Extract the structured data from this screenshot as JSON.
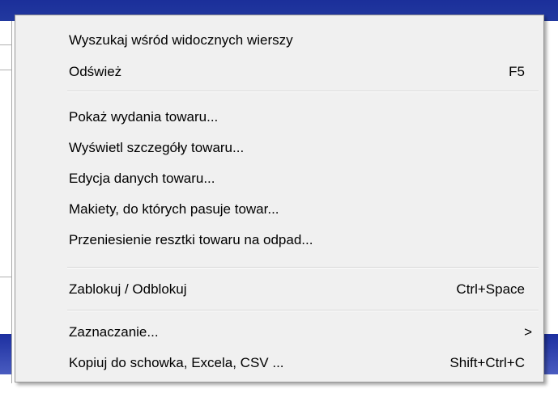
{
  "context_menu": {
    "items": [
      {
        "label": "Wyszukaj wśród widocznych wierszy",
        "shortcut": ""
      },
      {
        "label": "Odśwież",
        "shortcut": "F5"
      },
      {
        "label": "Pokaż wydania towaru...",
        "shortcut": ""
      },
      {
        "label": "Wyświetl szczegóły towaru...",
        "shortcut": ""
      },
      {
        "label": "Edycja danych towaru...",
        "shortcut": ""
      },
      {
        "label": "Makiety, do których pasuje towar...",
        "shortcut": ""
      },
      {
        "label": "Przeniesienie resztki towaru na odpad...",
        "shortcut": ""
      },
      {
        "label": "Zablokuj / Odblokuj",
        "shortcut": "Ctrl+Space"
      },
      {
        "label": "Zaznaczanie...",
        "submenu_arrow": ">"
      },
      {
        "label": "Kopiuj do schowka, Excela, CSV ...",
        "shortcut": "Shift+Ctrl+C"
      }
    ]
  },
  "background": {
    "topbar_color": "#1b2f9a",
    "menu_background": "#f0f0f0",
    "menu_border": "#979797"
  }
}
